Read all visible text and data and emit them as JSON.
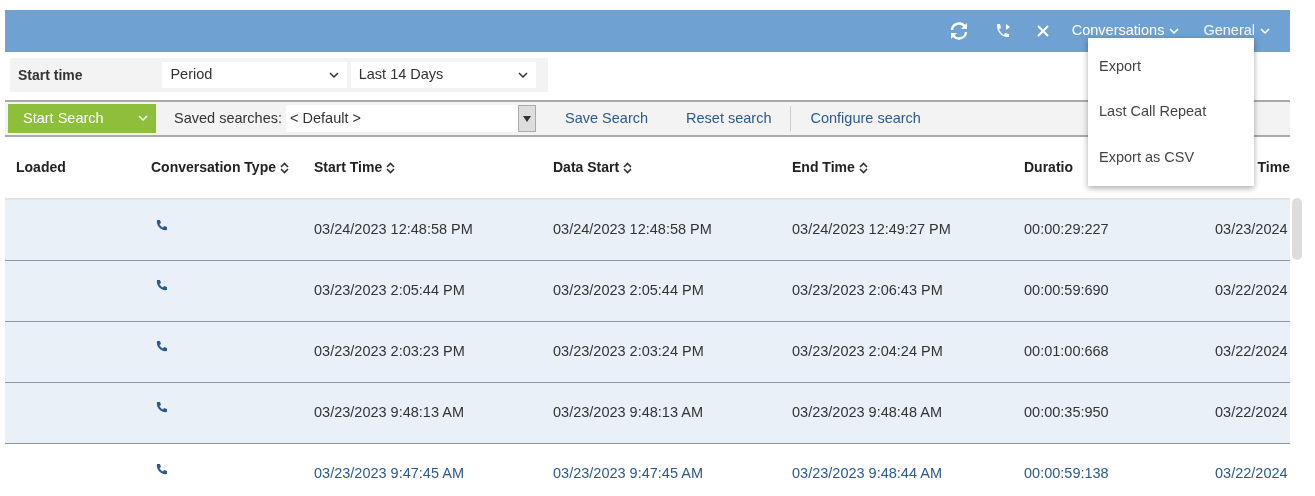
{
  "top_bar": {
    "menus": [
      {
        "label": "Conversations",
        "expanded": true,
        "items": [
          "Export",
          "Last Call Repeat",
          "Export as CSV"
        ]
      },
      {
        "label": "General",
        "expanded": false
      }
    ]
  },
  "filter": {
    "label": "Start time",
    "selects": [
      {
        "value": "Period"
      },
      {
        "value": "Last 14 Days"
      }
    ]
  },
  "search_bar": {
    "start_button": "Start Search",
    "saved_label": "Saved searches:",
    "saved_value": "< Default >",
    "actions": [
      "Save Search",
      "Reset search",
      "Configure search"
    ]
  },
  "table": {
    "columns": [
      {
        "label": "Loaded",
        "sortable": false
      },
      {
        "label": "Conversation Type",
        "sortable": true
      },
      {
        "label": "Start Time",
        "sortable": true
      },
      {
        "label": "Data Start",
        "sortable": true
      },
      {
        "label": "End Time",
        "sortable": true
      },
      {
        "label": "Duratio",
        "sortable": false
      },
      {
        "label": "Time",
        "sortable": false
      }
    ],
    "rows": [
      {
        "selected": true,
        "cells": [
          "",
          "",
          "03/24/2023 12:48:58 PM",
          "03/24/2023 12:48:58 PM",
          "03/24/2023 12:49:27 PM",
          "00:00:29:227",
          "03/23/2024"
        ]
      },
      {
        "selected": true,
        "cells": [
          "",
          "",
          "03/23/2023 2:05:44 PM",
          "03/23/2023 2:05:44 PM",
          "03/23/2023 2:06:43 PM",
          "00:00:59:690",
          "03/22/2024"
        ]
      },
      {
        "selected": true,
        "cells": [
          "",
          "",
          "03/23/2023 2:03:23 PM",
          "03/23/2023 2:03:24 PM",
          "03/23/2023 2:04:24 PM",
          "00:01:00:668",
          "03/22/2024"
        ]
      },
      {
        "selected": true,
        "cells": [
          "",
          "",
          "03/23/2023 9:48:13 AM",
          "03/23/2023 9:48:13 AM",
          "03/23/2023 9:48:48 AM",
          "00:00:35:950",
          "03/22/2024"
        ]
      },
      {
        "selected": false,
        "cells": [
          "",
          "",
          "03/23/2023 9:47:45 AM",
          "03/23/2023 9:47:45 AM",
          "03/23/2023 9:48:44 AM",
          "00:00:59:138",
          "03/22/2024"
        ]
      }
    ]
  }
}
